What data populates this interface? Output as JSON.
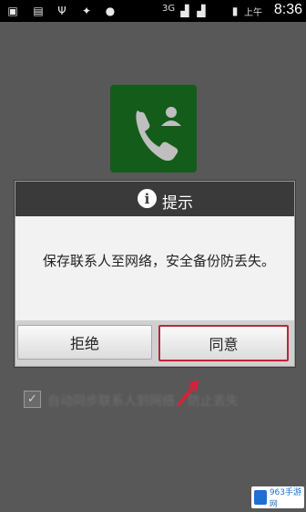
{
  "status_bar": {
    "network": "3G",
    "ampm": "上午",
    "time": "8:36"
  },
  "dialog": {
    "title": "提示",
    "message": "保存联系人至网络，安全备份防丢失。",
    "reject_label": "拒绝",
    "agree_label": "同意"
  },
  "background": {
    "checkbox_checked": true,
    "checkbox_label": "自动同步联系人到网络，防止丢失"
  },
  "watermark": {
    "text": "963手游网"
  },
  "colors": {
    "dialog_header": "#3a3a3a",
    "highlight_border": "#c0243a",
    "app_icon": "#1b7a22"
  }
}
